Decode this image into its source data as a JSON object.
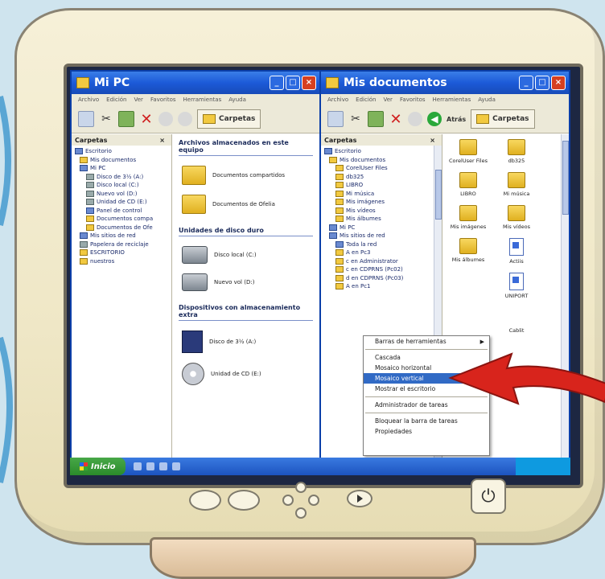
{
  "left_window": {
    "title": "Mi PC",
    "menu": [
      "Archivo",
      "Edición",
      "Ver",
      "Favoritos",
      "Herramientas",
      "Ayuda"
    ],
    "folders_button": "Carpetas",
    "pane_title": "Carpetas",
    "pane_close": "×",
    "tree": [
      "Escritorio",
      "Mis documentos",
      "Mi PC",
      "Disco de 3½ (A:)",
      "Disco local (C:)",
      "Nuevo vol (D:)",
      "Unidad de CD (E:)",
      "Panel de control",
      "Documentos compa",
      "Documentos de Ofe",
      "Mis sitios de red",
      "Papelera de reciclaje",
      "ESCRITORIO",
      "nuestros"
    ],
    "group_files": "Archivos almacenados en este equipo",
    "files": [
      "Documentos compartidos",
      "Documentos de Ofelia"
    ],
    "group_drives": "Unidades de disco duro",
    "drives": [
      "Disco local (C:)",
      "Nuevo vol (D:)"
    ],
    "group_removable": "Dispositivos con almacenamiento extra",
    "removable": [
      "Disco de 3½ (A:)",
      "Unidad de CD (E:)"
    ]
  },
  "right_window": {
    "title": "Mis documentos",
    "menu": [
      "Archivo",
      "Edición",
      "Ver",
      "Favoritos",
      "Herramientas",
      "Ayuda"
    ],
    "folders_button": "Carpetas",
    "back_label": "Atrás",
    "pane_title": "Carpetas",
    "pane_close": "×",
    "tree": [
      "Escritorio",
      "Mis documentos",
      "CorelUser Files",
      "db325",
      "LIBRO",
      "Mi música",
      "Mis imágenes",
      "Mis vídeos",
      "Mis álbumes",
      "Mi PC",
      "Mis sitios de red",
      "Toda la red",
      "A en Pc3",
      "c en Administrator",
      "c en CDPRNS (Pc02)",
      "d en CDPRNS (Pc03)",
      "A en Pc1"
    ],
    "icons": [
      "CorelUser Files",
      "db325",
      "LIBRO",
      "Mi música",
      "Mis imágenes",
      "Mis vídeos",
      "Mis álbumes",
      "Actiis",
      "",
      "UNIPORT",
      "",
      "Cablit"
    ]
  },
  "context_menu": {
    "items": [
      "Barras de herramientas",
      "Cascada",
      "Mosaico horizontal",
      "Mosaico vertical",
      "Mostrar el escritorio",
      "Administrador de tareas",
      "Bloquear la barra de tareas",
      "Propiedades"
    ],
    "highlighted_index": 3
  },
  "taskbar": {
    "start_label": "Inicio"
  },
  "colors": {
    "titlebar": "#1c5ad8",
    "highlight": "#316ac5",
    "arrow": "#d8241c",
    "start": "#2a8a2a"
  }
}
